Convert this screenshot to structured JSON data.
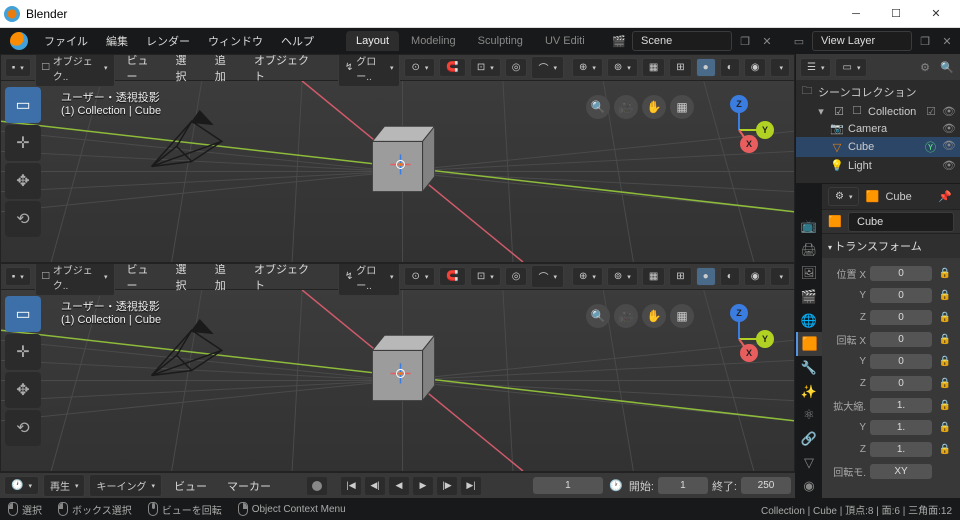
{
  "window": {
    "title": "Blender"
  },
  "menubar": {
    "items": [
      "ファイル",
      "編集",
      "レンダー",
      "ウィンドウ",
      "ヘルプ"
    ]
  },
  "tabs": {
    "items": [
      "Layout",
      "Modeling",
      "Sculpting",
      "UV Editi"
    ],
    "active": 0
  },
  "scene": {
    "value": "Scene"
  },
  "viewlayer": {
    "value": "View Layer"
  },
  "viewport_header": {
    "mode": "オブジェク..",
    "view": "ビュー",
    "select": "選択",
    "add": "追加",
    "object": "オブジェクト",
    "orient": "グロー.."
  },
  "vp_overlay": {
    "line1": "ユーザー・透視投影",
    "line2": "(1) Collection | Cube"
  },
  "timeline": {
    "playback": "再生",
    "keying": "キーイング",
    "view": "ビュー",
    "marker": "マーカー",
    "current": "1",
    "start_label": "開始:",
    "start": "1",
    "end_label": "終了:",
    "end": "250"
  },
  "outliner": {
    "title": "シーンコレクション",
    "items": [
      {
        "name": "Collection",
        "icon": "box",
        "depth": 1
      },
      {
        "name": "Camera",
        "icon": "camera",
        "depth": 2
      },
      {
        "name": "Cube",
        "icon": "mesh",
        "depth": 2,
        "selected": true
      },
      {
        "name": "Light",
        "icon": "light",
        "depth": 2
      }
    ]
  },
  "properties": {
    "object_name": "Cube",
    "panel_title": "トランスフォーム",
    "location": {
      "label": "位置",
      "x": "0",
      "y": "0",
      "z": "0"
    },
    "rotation": {
      "label": "回転",
      "x": "0",
      "y": "0",
      "z": "0"
    },
    "scale": {
      "label": "拡大縮.",
      "x": "1.",
      "y": "1.",
      "z": "1."
    },
    "rotmode": {
      "label": "回転モ.",
      "value": "XY"
    }
  },
  "statusbar": {
    "select": "選択",
    "box": "ボックス選択",
    "rotate": "ビューを回転",
    "context": "Object Context Menu",
    "info": "Collection | Cube | 頂点:8 | 面:6 | 三角面:12"
  },
  "colors": {
    "accent": "#5294e2"
  }
}
